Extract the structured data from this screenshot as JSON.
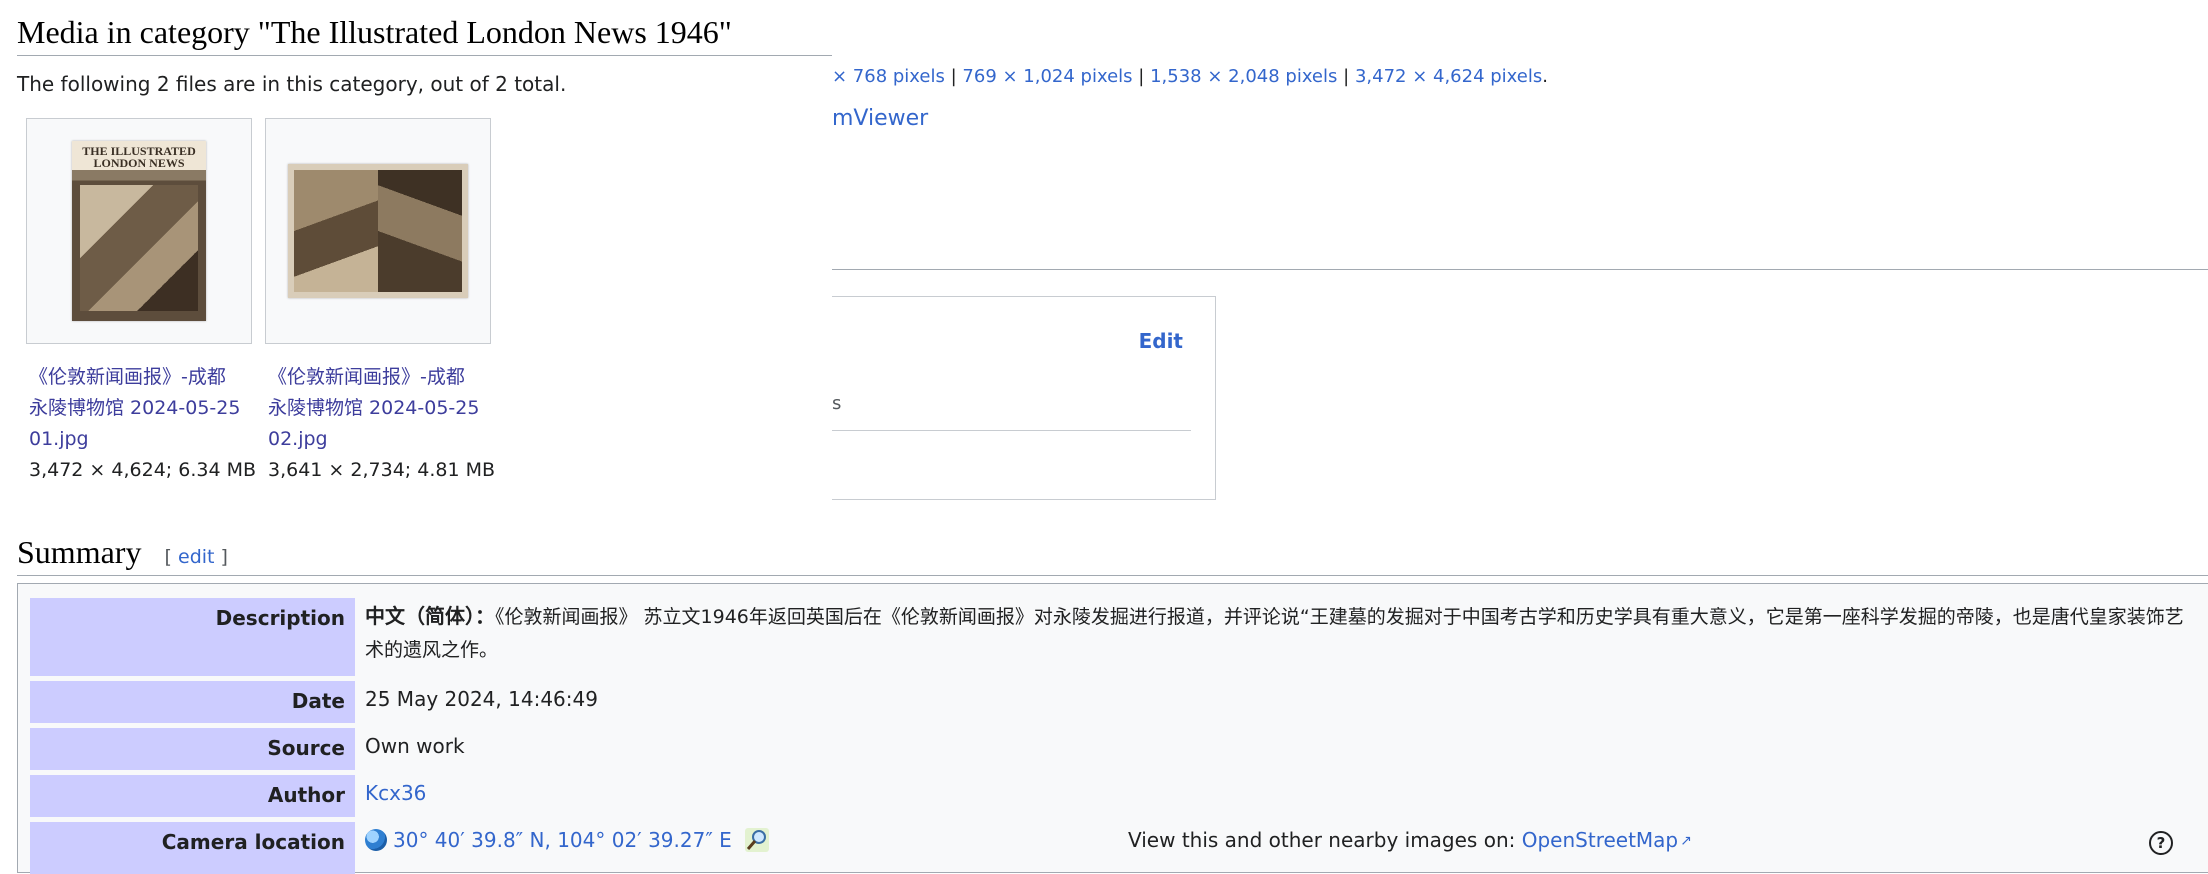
{
  "file_page": {
    "resolutions": {
      "items": [
        "× 768 pixels",
        "769 × 1,024 pixels",
        "1,538 × 2,048 pixels",
        "3,472 × 4,624 pixels"
      ],
      "end": "."
    },
    "media_viewer_link": "mViewer",
    "box": {
      "edit_label": "Edit",
      "partial_text": "s"
    }
  },
  "category": {
    "title": "Media in category \"The Illustrated London News 1946\"",
    "count_text": "The following 2 files are in this category, out of 2 total.",
    "files": [
      {
        "name": "《伦敦新闻画报》-成都永陵博物馆 2024-05-25 01.jpg",
        "name_line1": "《伦敦新闻画报》-成都",
        "name_line2": "永陵博物馆 2024-05-25",
        "name_line3": "01.jpg",
        "meta": "3,472 × 4,624; 6.34 MB",
        "thumb_masthead": "THE ILLUSTRATED LONDON NEWS"
      },
      {
        "name": "《伦敦新闻画报》-成都永陵博物馆 2024-05-25 02.jpg",
        "name_line1": "《伦敦新闻画报》-成都",
        "name_line2": "永陵博物馆 2024-05-25",
        "name_line3": "02.jpg",
        "meta": "3,641 × 2,734; 4.81 MB"
      }
    ]
  },
  "summary": {
    "title": "Summary",
    "edit_open": "[",
    "edit_label": "edit",
    "edit_close": "]",
    "rows": {
      "description": {
        "label": "Description",
        "lang": "中文（简体）：",
        "text": "《伦敦新闻画报》 苏立文1946年返回英国后在《伦敦新闻画报》对永陵发掘进行报道，并评论说“王建墓的发掘对于中国考古学和历史学具有重大意义，它是第一座科学发掘的帝陵，也是唐代皇家装饰艺术的遗风之作。"
      },
      "date": {
        "label": "Date",
        "value": "25 May 2024, 14:46:49"
      },
      "source": {
        "label": "Source",
        "value": "Own work"
      },
      "author": {
        "label": "Author",
        "value": "Kcx36"
      },
      "camera_location": {
        "label": "Camera location",
        "coords": "30° 40′ 39.8″ N, 104° 02′ 39.27″ E",
        "osm_prefix": "View this and other nearby images on:",
        "osm_link": "OpenStreetMap",
        "help": "?"
      }
    }
  },
  "colors": {
    "link": "#3366cc",
    "visited_link": "#3d3d9c",
    "label_bg": "#ccccff",
    "border": "#a2a9b1",
    "table_bg": "#f8f9fa"
  }
}
